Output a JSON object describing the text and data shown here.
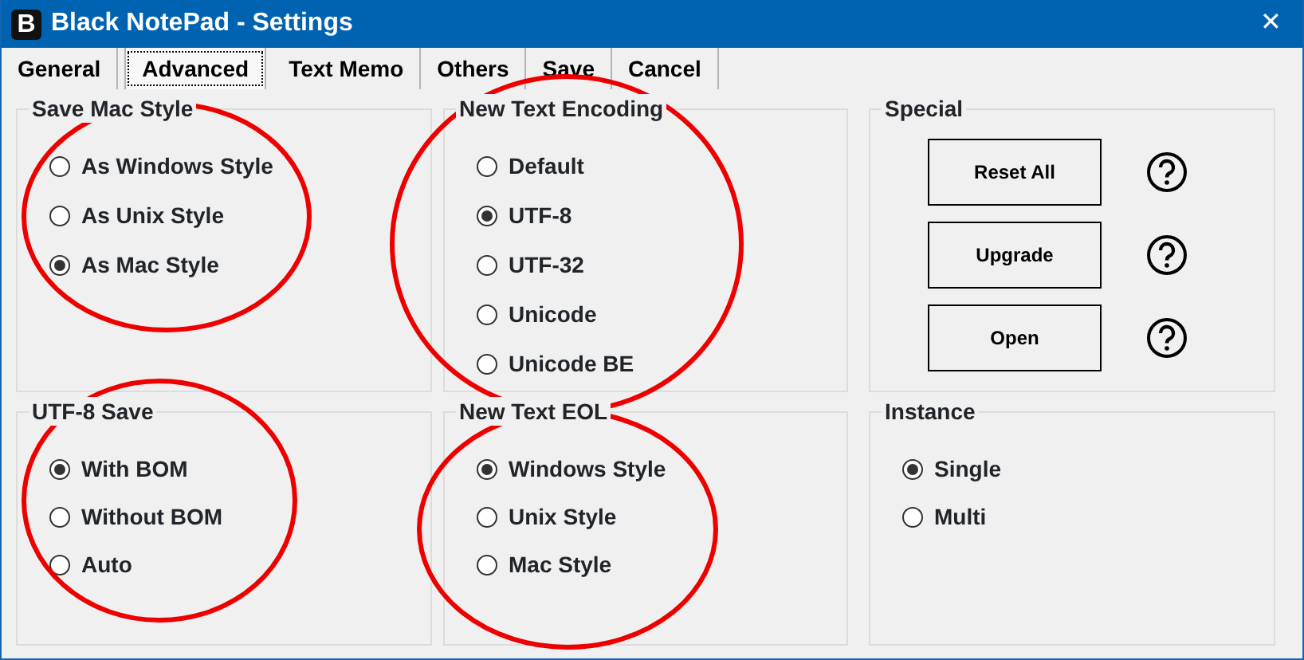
{
  "window": {
    "app_icon": "B",
    "title": "Black NotePad - Settings",
    "close": "✕"
  },
  "tabs": [
    {
      "label": "General",
      "selected": false
    },
    {
      "label": "Advanced",
      "selected": true
    },
    {
      "label": "Text Memo",
      "selected": false
    },
    {
      "label": "Others",
      "selected": false
    },
    {
      "label": "Save",
      "selected": false
    },
    {
      "label": "Cancel",
      "selected": false
    }
  ],
  "groups": [
    {
      "title": "Save Mac Style",
      "kind": "radios",
      "circled": true,
      "options": [
        {
          "label": "As Windows Style",
          "selected": false
        },
        {
          "label": "As Unix Style",
          "selected": false
        },
        {
          "label": "As Mac Style",
          "selected": true
        }
      ]
    },
    {
      "title": "New Text Encoding",
      "kind": "radios",
      "circled": true,
      "options": [
        {
          "label": "Default",
          "selected": false
        },
        {
          "label": "UTF-8",
          "selected": true
        },
        {
          "label": "UTF-32",
          "selected": false
        },
        {
          "label": "Unicode",
          "selected": false
        },
        {
          "label": "Unicode BE",
          "selected": false
        }
      ]
    },
    {
      "title": "Special",
      "kind": "buttons",
      "circled": false,
      "buttons": [
        "Reset All",
        "Upgrade",
        "Open"
      ]
    },
    {
      "title": "UTF-8 Save",
      "kind": "radios",
      "circled": true,
      "options": [
        {
          "label": "With BOM",
          "selected": true
        },
        {
          "label": "Without BOM",
          "selected": false
        },
        {
          "label": "Auto",
          "selected": false
        }
      ]
    },
    {
      "title": "New Text EOL",
      "kind": "radios",
      "circled": true,
      "options": [
        {
          "label": "Windows Style",
          "selected": true
        },
        {
          "label": "Unix Style",
          "selected": false
        },
        {
          "label": "Mac Style",
          "selected": false
        }
      ]
    },
    {
      "title": "Instance",
      "kind": "radios",
      "circled": false,
      "options": [
        {
          "label": "Single",
          "selected": true
        },
        {
          "label": "Multi",
          "selected": false
        }
      ]
    }
  ]
}
